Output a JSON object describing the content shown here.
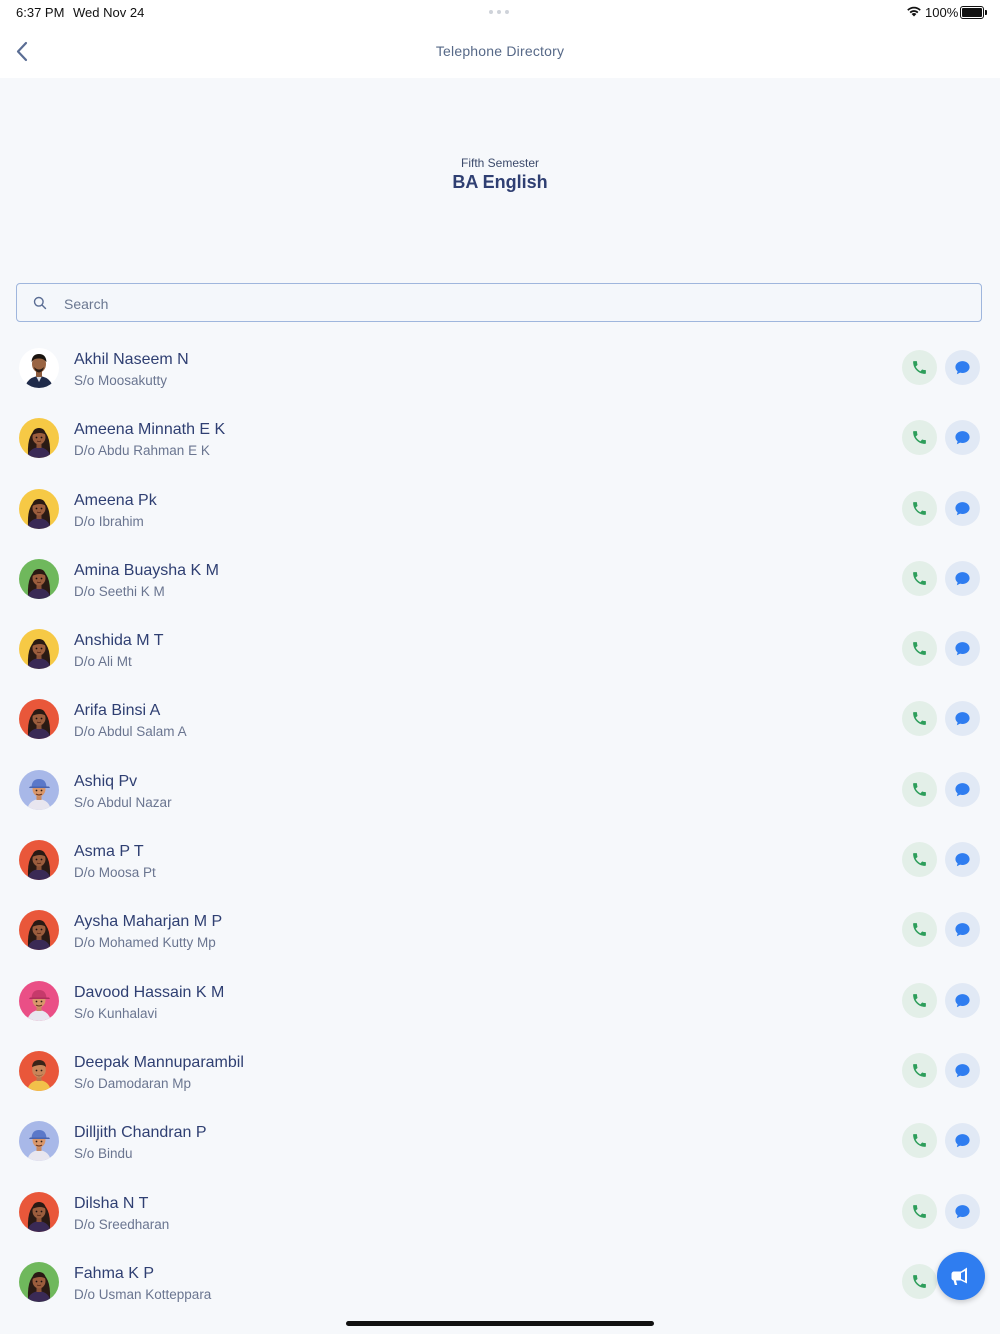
{
  "status_bar": {
    "time": "6:37 PM",
    "date": "Wed Nov 24",
    "battery": "100%"
  },
  "nav": {
    "title": "Telephone Directory",
    "back_icon": "chevron-left-icon"
  },
  "header": {
    "semester": "Fifth Semester",
    "course": "BA English"
  },
  "search": {
    "placeholder": "Search",
    "value": ""
  },
  "colors": {
    "accent": "#2f7df0",
    "call_green": "#2e9e5b",
    "call_bg": "#e3efe8",
    "msg_blue": "#2f7df0",
    "msg_bg": "#e1e9f5",
    "title_navy": "#2f3f72"
  },
  "contacts": [
    {
      "name": "Akhil Naseem N",
      "relation": "S/o Moosakutty",
      "avatar": "photo",
      "avatar_bg": "#ffffff"
    },
    {
      "name": "Ameena Minnath E K",
      "relation": "D/o Abdu Rahman E K",
      "avatar": "female",
      "avatar_bg": "#f6c945"
    },
    {
      "name": "Ameena Pk",
      "relation": "D/o Ibrahim",
      "avatar": "female",
      "avatar_bg": "#f6c945"
    },
    {
      "name": "Amina Buaysha K M",
      "relation": "D/o Seethi K M",
      "avatar": "female",
      "avatar_bg": "#6fb85c"
    },
    {
      "name": "Anshida M T",
      "relation": "D/o Ali Mt",
      "avatar": "female",
      "avatar_bg": "#f6c945"
    },
    {
      "name": "Arifa Binsi A",
      "relation": "D/o Abdul Salam A",
      "avatar": "female",
      "avatar_bg": "#e9573a"
    },
    {
      "name": "Ashiq Pv",
      "relation": "S/o Abdul Nazar",
      "avatar": "male-cap",
      "avatar_bg": "#a8b8e8"
    },
    {
      "name": "Asma P T",
      "relation": "D/o Moosa Pt",
      "avatar": "female",
      "avatar_bg": "#e9573a"
    },
    {
      "name": "Aysha Maharjan M P",
      "relation": "D/o Mohamed Kutty Mp",
      "avatar": "female",
      "avatar_bg": "#e9573a"
    },
    {
      "name": "Davood Hassain K M",
      "relation": "S/o Kunhalavi",
      "avatar": "male-cap",
      "avatar_bg": "#ea4f86"
    },
    {
      "name": "Deepak Mannuparambil",
      "relation": "S/o Damodaran Mp",
      "avatar": "male",
      "avatar_bg": "#e9573a"
    },
    {
      "name": "Dilljith Chandran P",
      "relation": "S/o Bindu",
      "avatar": "male-cap",
      "avatar_bg": "#a8b8e8"
    },
    {
      "name": "Dilsha N T",
      "relation": "D/o Sreedharan",
      "avatar": "female",
      "avatar_bg": "#e9573a"
    },
    {
      "name": "Fahma K P",
      "relation": "D/o Usman Kotteppara",
      "avatar": "female",
      "avatar_bg": "#6fb85c"
    }
  ],
  "fab": {
    "icon": "megaphone-icon"
  }
}
